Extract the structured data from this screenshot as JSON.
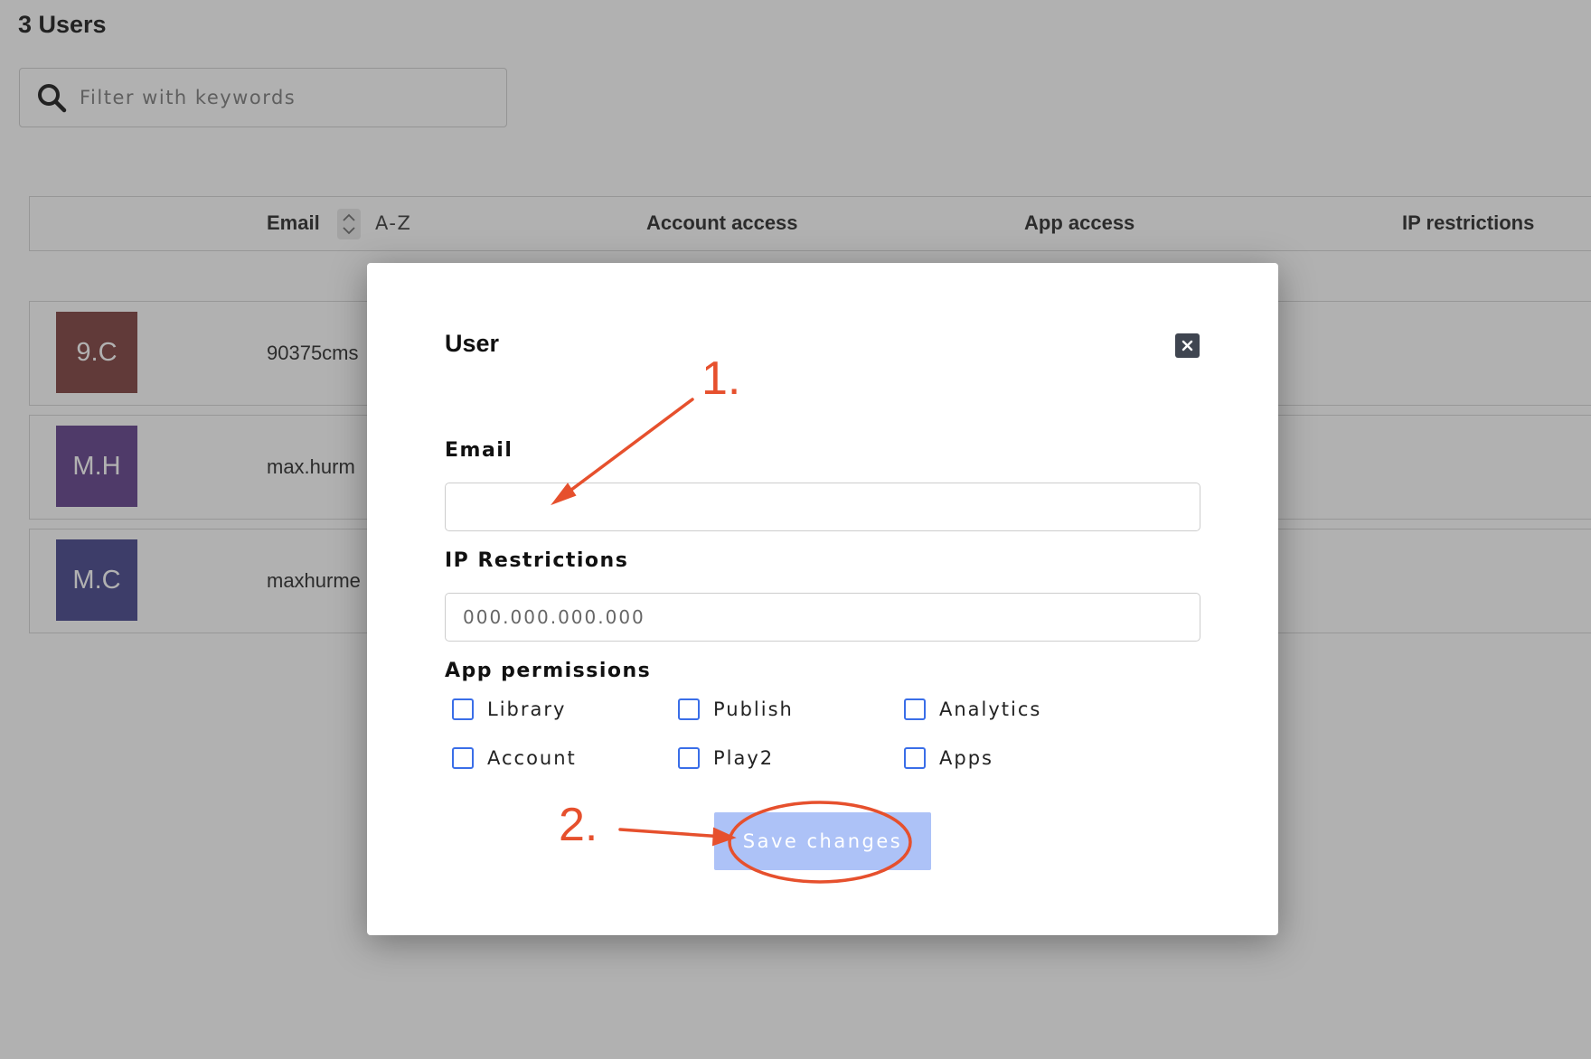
{
  "page": {
    "title": "3 Users",
    "search": {
      "placeholder": "Filter with keywords"
    }
  },
  "table": {
    "columns": {
      "email": "Email",
      "sort_label": "A-Z",
      "account_access": "Account access",
      "app_access": "App access",
      "ip_restrictions": "IP restrictions"
    },
    "rows": [
      {
        "initials": "9.C",
        "email": "90375cms",
        "avatar_color": "#7a3a38"
      },
      {
        "initials": "M.H",
        "email": "max.hurm",
        "avatar_color": "#5d3a87"
      },
      {
        "initials": "M.C",
        "email": "maxhurme",
        "avatar_color": "#3f3f88"
      }
    ]
  },
  "modal": {
    "title": "User",
    "email_label": "Email",
    "email_value": "",
    "ip_label": "IP Restrictions",
    "ip_placeholder": "000.000.000.000",
    "permissions_label": "App permissions",
    "permissions": [
      "Library",
      "Publish",
      "Analytics",
      "Account",
      "Play2",
      "Apps"
    ],
    "save_label": "Save changes"
  },
  "annotations": {
    "step1": "1.",
    "step2": "2.",
    "color": "#e6502d"
  },
  "icons": {
    "search": "search-icon",
    "close": "close-icon",
    "sort": "sort-toggle-icon"
  }
}
